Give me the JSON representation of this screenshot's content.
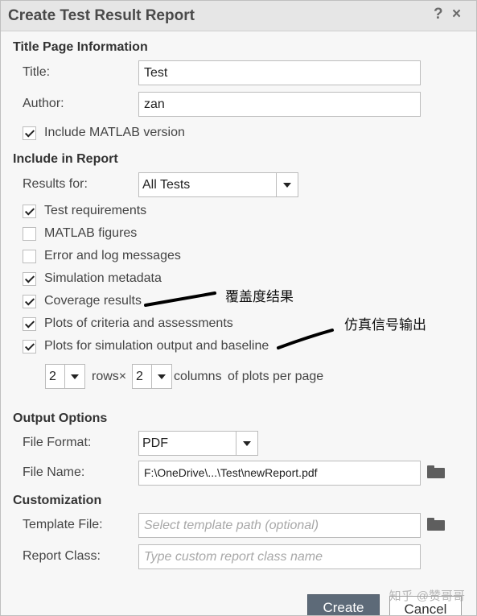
{
  "dialog": {
    "title": "Create Test Result Report",
    "help": "?",
    "close": "×"
  },
  "title_page": {
    "heading": "Title Page Information",
    "title_label": "Title:",
    "title_value": "Test",
    "author_label": "Author:",
    "author_value": "zan",
    "include_matlab_label": "Include MATLAB version",
    "include_matlab_checked": true
  },
  "include": {
    "heading": "Include in Report",
    "results_for_label": "Results for:",
    "results_for_value": "All Tests",
    "items": [
      {
        "label": "Test requirements",
        "checked": true
      },
      {
        "label": "MATLAB figures",
        "checked": false
      },
      {
        "label": "Error and log messages",
        "checked": false
      },
      {
        "label": "Simulation metadata",
        "checked": true
      },
      {
        "label": "Coverage results",
        "checked": true
      },
      {
        "label": "Plots of criteria and assessments",
        "checked": true
      },
      {
        "label": "Plots for simulation output and baseline",
        "checked": true
      }
    ],
    "rows_value": "2",
    "rows_label": "rows×",
    "cols_value": "2",
    "cols_label": "columns",
    "per_page_label": "of plots per page"
  },
  "output": {
    "heading": "Output Options",
    "format_label": "File Format:",
    "format_value": "PDF",
    "name_label": "File Name:",
    "name_value": "F:\\OneDrive\\...\\Test\\newReport.pdf"
  },
  "custom": {
    "heading": "Customization",
    "template_label": "Template File:",
    "template_placeholder": "Select template path (optional)",
    "class_label": "Report Class:",
    "class_placeholder": "Type custom report class name"
  },
  "buttons": {
    "create": "Create",
    "cancel": "Cancel"
  },
  "annotations": {
    "coverage": "覆盖度结果",
    "simulation": "仿真信号输出"
  },
  "watermark": "知乎 @赞哥哥",
  "colors": {
    "primary_button": "#5d6a78",
    "titlebar": "#e6e6e6",
    "panel": "#f7f7f7"
  }
}
